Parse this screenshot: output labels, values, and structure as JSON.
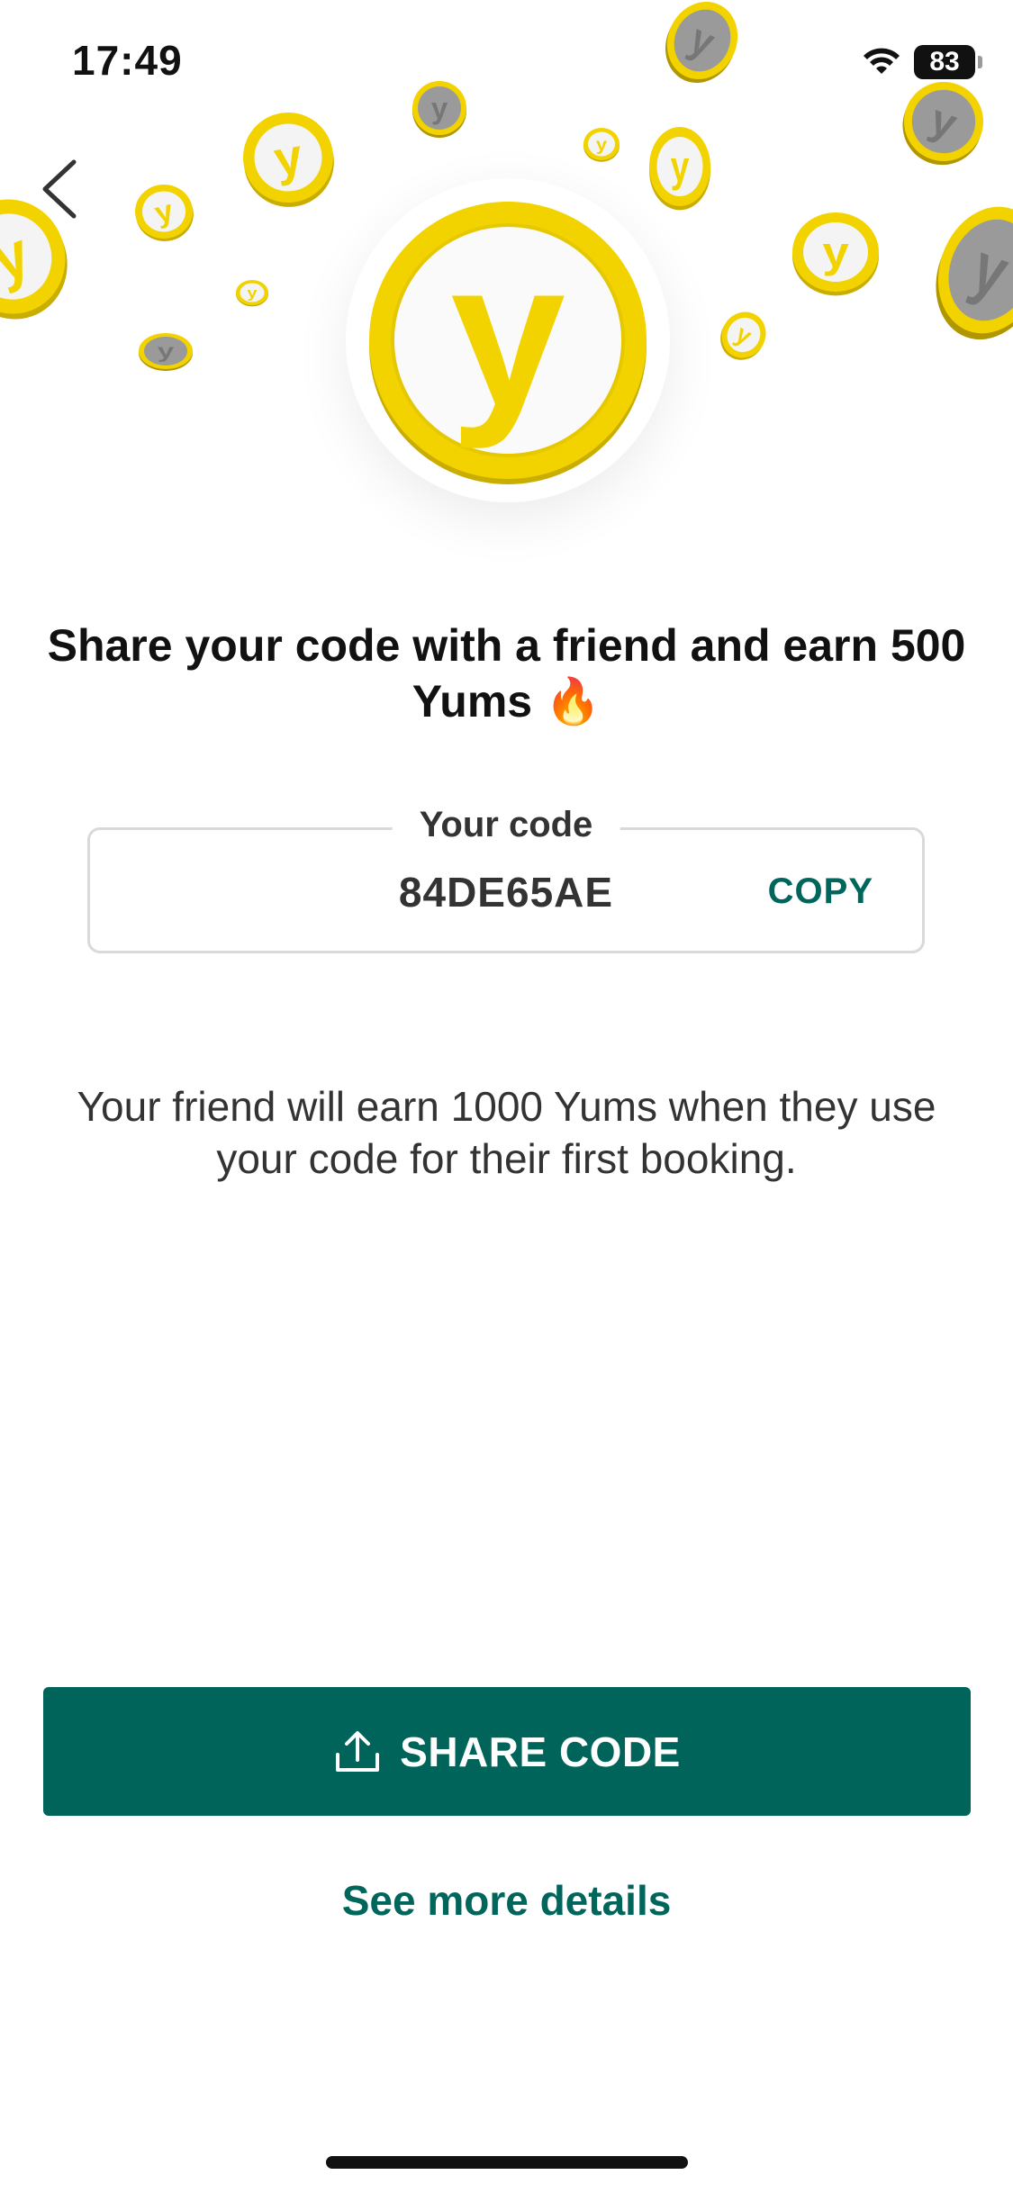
{
  "status_bar": {
    "time": "17:49",
    "battery_level": "83",
    "wifi_icon": "wifi-icon"
  },
  "navigation": {
    "back_icon": "chevron-left-icon"
  },
  "hero": {
    "coin_letter": "y",
    "brand_color": "#f2d300"
  },
  "headline": "Share your code with a friend and earn 500 Yums 🔥",
  "code_box": {
    "label": "Your code",
    "value": "84DE65AE",
    "copy_label": "COPY"
  },
  "description": "Your friend will earn 1000 Yums when they use your code for their first booking.",
  "share_button": {
    "label": "SHARE CODE",
    "icon": "share-upload-icon"
  },
  "details_link": "See more details",
  "colors": {
    "accent": "#00645a",
    "coin_yellow": "#f2d300",
    "coin_gray": "#999999"
  }
}
